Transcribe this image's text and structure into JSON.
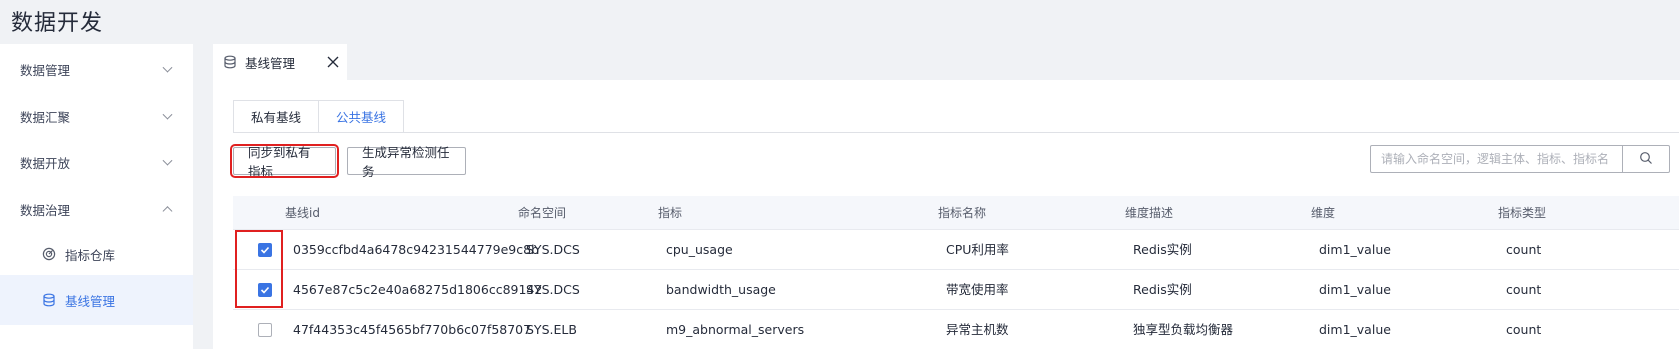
{
  "page_title": "数据开发",
  "sidebar": {
    "items": [
      {
        "label": "数据管理",
        "expanded": false
      },
      {
        "label": "数据汇聚",
        "expanded": false
      },
      {
        "label": "数据开放",
        "expanded": false
      },
      {
        "label": "数据治理",
        "expanded": true
      },
      {
        "label": "指标仓库",
        "icon": "gauge-icon"
      },
      {
        "label": "基线管理",
        "icon": "database-icon",
        "active": true
      }
    ]
  },
  "page_tabs": [
    {
      "label": "基线管理",
      "icon": "database-icon",
      "closable": true
    }
  ],
  "sub_tabs": [
    {
      "label": "私有基线",
      "selected": false
    },
    {
      "label": "公共基线",
      "selected": true
    }
  ],
  "toolbar": {
    "sync_label": "同步到私有指标",
    "anomaly_label": "生成异常检测任务",
    "search_placeholder": "请输入命名空间，逻辑主体、指标、指标名"
  },
  "table": {
    "columns": [
      "基线id",
      "命名空间",
      "指标",
      "指标名称",
      "维度描述",
      "维度",
      "指标类型"
    ],
    "rows": [
      {
        "checked": true,
        "cells": [
          "0359ccfbd4a6478c94231544779e9c8b",
          "SYS.DCS",
          "cpu_usage",
          "CPU利用率",
          "Redis实例",
          "dim1_value",
          "count"
        ]
      },
      {
        "checked": true,
        "cells": [
          "4567e87c5c2e40a68275d1806cc89142",
          "SYS.DCS",
          "bandwidth_usage",
          "带宽使用率",
          "Redis实例",
          "dim1_value",
          "count"
        ]
      },
      {
        "checked": false,
        "cells": [
          "47f44353c45f4565bf770b6c07f58707",
          "SYS.ELB",
          "m9_abnormal_servers",
          "异常主机数",
          "独享型负载均衡器",
          "dim1_value",
          "count"
        ]
      }
    ]
  },
  "colors": {
    "accent": "#3a74e3",
    "highlight_border": "#e02020",
    "active_menu_bg": "#eef3fd"
  }
}
